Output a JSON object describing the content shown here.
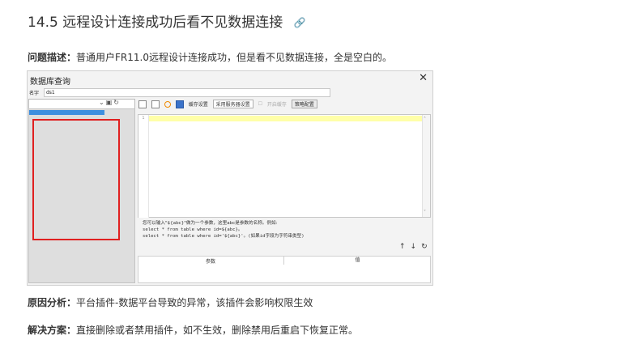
{
  "heading": "14.5 远程设计连接成功后看不见数据连接",
  "problem": {
    "label": "问题描述：",
    "text": "普通用户FR11.0远程设计连接成功，但是看不见数据连接，全是空白的。"
  },
  "cause": {
    "label": "原因分析：",
    "text": "平台插件-数据平台导致的异常，该插件会影响权限生效"
  },
  "solution": {
    "label": "解决方案：",
    "text": "直接删除或者禁用插件，如不生效，删除禁用后重启下恢复正常。"
  },
  "screenshot": {
    "title": "数据库查询",
    "close": "✕",
    "name_label": "名字",
    "name_value": "ds1",
    "toolbar": {
      "cache_setting": "缓存设置",
      "server_setting": "采用服务器设置",
      "enable_cache": "开启缓存",
      "advanced": "策略配置"
    },
    "line_number": "1",
    "hint_line1": "您可以输入\"${abc}\"做为一个参数，这里abc是参数的名称。例如:",
    "hint_line2": "select * from table where id=${abc}。",
    "hint_line3": "select * from table where id='${abc}'。(如果id字段为字符串类型)",
    "table_header": {
      "param": "参数",
      "value": "值"
    }
  }
}
